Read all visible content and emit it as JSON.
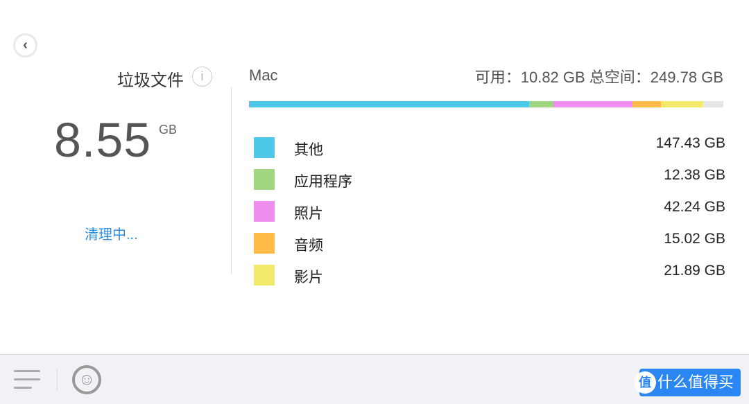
{
  "header": {
    "back_icon": "chevron-left-icon"
  },
  "junk": {
    "title": "垃圾文件",
    "info_icon": "i",
    "size": "8.55",
    "unit": "GB",
    "status": "清理中..."
  },
  "disk": {
    "name": "Mac",
    "summary": "可用：10.82 GB 总空间：249.78 GB",
    "free_gb": 10.82,
    "total_gb": 249.78
  },
  "categories": [
    {
      "label": "其他",
      "value": "147.43 GB",
      "gb": 147.43,
      "color": "#4cc8e8"
    },
    {
      "label": "应用程序",
      "value": "12.38 GB",
      "gb": 12.38,
      "color": "#9fd67f"
    },
    {
      "label": "照片",
      "value": "42.24 GB",
      "gb": 42.24,
      "color": "#f08ef0"
    },
    {
      "label": "音频",
      "value": "15.02 GB",
      "gb": 15.02,
      "color": "#ffbb48"
    },
    {
      "label": "影片",
      "value": "21.89 GB",
      "gb": 21.89,
      "color": "#f2ea6a"
    }
  ],
  "footer": {
    "menu_icon": "menu-icon",
    "support_icon": "support-icon",
    "watermark": "什么值得买",
    "watermark_badge": "值"
  }
}
